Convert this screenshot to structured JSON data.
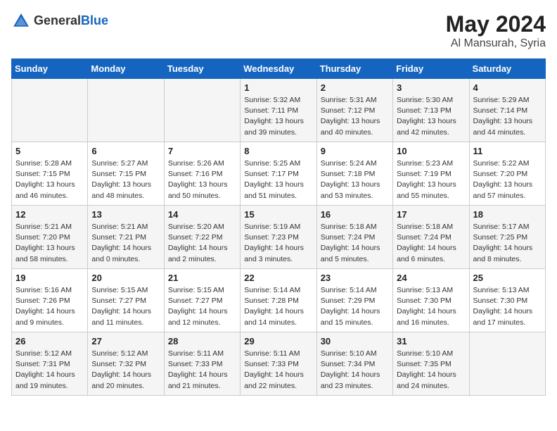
{
  "header": {
    "logo_general": "General",
    "logo_blue": "Blue",
    "title": "May 2024",
    "location": "Al Mansurah, Syria"
  },
  "weekdays": [
    "Sunday",
    "Monday",
    "Tuesday",
    "Wednesday",
    "Thursday",
    "Friday",
    "Saturday"
  ],
  "weeks": [
    [
      {
        "day": "",
        "content": ""
      },
      {
        "day": "",
        "content": ""
      },
      {
        "day": "",
        "content": ""
      },
      {
        "day": "1",
        "content": "Sunrise: 5:32 AM\nSunset: 7:11 PM\nDaylight: 13 hours\nand 39 minutes."
      },
      {
        "day": "2",
        "content": "Sunrise: 5:31 AM\nSunset: 7:12 PM\nDaylight: 13 hours\nand 40 minutes."
      },
      {
        "day": "3",
        "content": "Sunrise: 5:30 AM\nSunset: 7:13 PM\nDaylight: 13 hours\nand 42 minutes."
      },
      {
        "day": "4",
        "content": "Sunrise: 5:29 AM\nSunset: 7:14 PM\nDaylight: 13 hours\nand 44 minutes."
      }
    ],
    [
      {
        "day": "5",
        "content": "Sunrise: 5:28 AM\nSunset: 7:15 PM\nDaylight: 13 hours\nand 46 minutes."
      },
      {
        "day": "6",
        "content": "Sunrise: 5:27 AM\nSunset: 7:15 PM\nDaylight: 13 hours\nand 48 minutes."
      },
      {
        "day": "7",
        "content": "Sunrise: 5:26 AM\nSunset: 7:16 PM\nDaylight: 13 hours\nand 50 minutes."
      },
      {
        "day": "8",
        "content": "Sunrise: 5:25 AM\nSunset: 7:17 PM\nDaylight: 13 hours\nand 51 minutes."
      },
      {
        "day": "9",
        "content": "Sunrise: 5:24 AM\nSunset: 7:18 PM\nDaylight: 13 hours\nand 53 minutes."
      },
      {
        "day": "10",
        "content": "Sunrise: 5:23 AM\nSunset: 7:19 PM\nDaylight: 13 hours\nand 55 minutes."
      },
      {
        "day": "11",
        "content": "Sunrise: 5:22 AM\nSunset: 7:20 PM\nDaylight: 13 hours\nand 57 minutes."
      }
    ],
    [
      {
        "day": "12",
        "content": "Sunrise: 5:21 AM\nSunset: 7:20 PM\nDaylight: 13 hours\nand 58 minutes."
      },
      {
        "day": "13",
        "content": "Sunrise: 5:21 AM\nSunset: 7:21 PM\nDaylight: 14 hours\nand 0 minutes."
      },
      {
        "day": "14",
        "content": "Sunrise: 5:20 AM\nSunset: 7:22 PM\nDaylight: 14 hours\nand 2 minutes."
      },
      {
        "day": "15",
        "content": "Sunrise: 5:19 AM\nSunset: 7:23 PM\nDaylight: 14 hours\nand 3 minutes."
      },
      {
        "day": "16",
        "content": "Sunrise: 5:18 AM\nSunset: 7:24 PM\nDaylight: 14 hours\nand 5 minutes."
      },
      {
        "day": "17",
        "content": "Sunrise: 5:18 AM\nSunset: 7:24 PM\nDaylight: 14 hours\nand 6 minutes."
      },
      {
        "day": "18",
        "content": "Sunrise: 5:17 AM\nSunset: 7:25 PM\nDaylight: 14 hours\nand 8 minutes."
      }
    ],
    [
      {
        "day": "19",
        "content": "Sunrise: 5:16 AM\nSunset: 7:26 PM\nDaylight: 14 hours\nand 9 minutes."
      },
      {
        "day": "20",
        "content": "Sunrise: 5:15 AM\nSunset: 7:27 PM\nDaylight: 14 hours\nand 11 minutes."
      },
      {
        "day": "21",
        "content": "Sunrise: 5:15 AM\nSunset: 7:27 PM\nDaylight: 14 hours\nand 12 minutes."
      },
      {
        "day": "22",
        "content": "Sunrise: 5:14 AM\nSunset: 7:28 PM\nDaylight: 14 hours\nand 14 minutes."
      },
      {
        "day": "23",
        "content": "Sunrise: 5:14 AM\nSunset: 7:29 PM\nDaylight: 14 hours\nand 15 minutes."
      },
      {
        "day": "24",
        "content": "Sunrise: 5:13 AM\nSunset: 7:30 PM\nDaylight: 14 hours\nand 16 minutes."
      },
      {
        "day": "25",
        "content": "Sunrise: 5:13 AM\nSunset: 7:30 PM\nDaylight: 14 hours\nand 17 minutes."
      }
    ],
    [
      {
        "day": "26",
        "content": "Sunrise: 5:12 AM\nSunset: 7:31 PM\nDaylight: 14 hours\nand 19 minutes."
      },
      {
        "day": "27",
        "content": "Sunrise: 5:12 AM\nSunset: 7:32 PM\nDaylight: 14 hours\nand 20 minutes."
      },
      {
        "day": "28",
        "content": "Sunrise: 5:11 AM\nSunset: 7:33 PM\nDaylight: 14 hours\nand 21 minutes."
      },
      {
        "day": "29",
        "content": "Sunrise: 5:11 AM\nSunset: 7:33 PM\nDaylight: 14 hours\nand 22 minutes."
      },
      {
        "day": "30",
        "content": "Sunrise: 5:10 AM\nSunset: 7:34 PM\nDaylight: 14 hours\nand 23 minutes."
      },
      {
        "day": "31",
        "content": "Sunrise: 5:10 AM\nSunset: 7:35 PM\nDaylight: 14 hours\nand 24 minutes."
      },
      {
        "day": "",
        "content": ""
      }
    ]
  ]
}
